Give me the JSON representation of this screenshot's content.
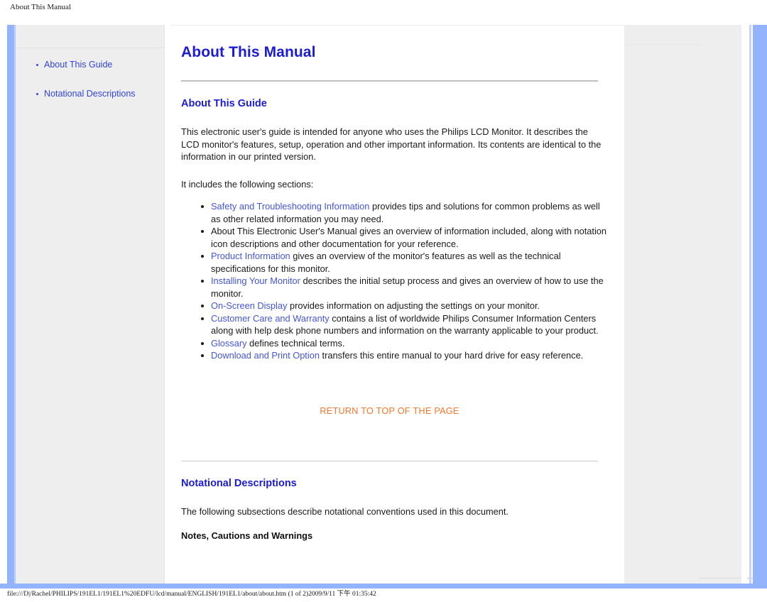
{
  "window": {
    "header_title": "About This Manual"
  },
  "sidebar": {
    "items": [
      {
        "label": "About This Guide"
      },
      {
        "label": "Notational Descriptions"
      }
    ]
  },
  "content": {
    "title": "About This Manual",
    "section_about": {
      "heading": "About This Guide",
      "paragraph_1": "This electronic user's guide is intended for anyone who uses the Philips LCD Monitor. It describes the LCD monitor's features, setup, operation and other important information. Its contents are identical to the information in our printed version.",
      "paragraph_2": "It includes the following sections:",
      "bullets": [
        {
          "link": "Safety and Troubleshooting Information",
          "text": " provides tips and solutions for common problems as well as other related information you may need."
        },
        {
          "link": "",
          "text": "About This Electronic User's Manual gives an overview of information included, along with notation icon descriptions and other documentation for your reference."
        },
        {
          "link": "Product Information",
          "text": " gives an overview of the monitor's features as well as the technical specifications for this monitor."
        },
        {
          "link": "Installing Your Monitor",
          "text": " describes the initial setup process and gives an overview of how to use the monitor."
        },
        {
          "link": "On-Screen Display",
          "text": " provides information on adjusting the settings on your monitor."
        },
        {
          "link": "Customer Care and Warranty",
          "text": " contains a list of worldwide Philips Consumer Information Centers along with help desk phone numbers and information on the warranty applicable to your product."
        },
        {
          "link": "Glossary",
          "text": " defines technical terms."
        },
        {
          "link": "Download and Print Option",
          "text": " transfers this entire manual to your hard drive for easy reference."
        }
      ],
      "return_to_top": "RETURN TO TOP OF THE PAGE"
    },
    "section_notational": {
      "heading": "Notational Descriptions",
      "paragraph_1": "The following subsections describe notational conventions used in this document.",
      "subheading": "Notes, Cautions and Warnings"
    }
  },
  "footer": {
    "path": "file:///D|/Rachel/PHILIPS/191EL1/191EL1%20EDFU/lcd/manual/ENGLISH/191EL1/about/about.htm (1 of 2)2009/9/11 下午 01:35:42"
  },
  "colors": {
    "heading_blue": "#1b1bd9",
    "link_blue": "#4455dd",
    "return_orange": "#f4762a",
    "rail_blue": "#93b3fc",
    "sidebar_gray": "#eeeeee"
  }
}
